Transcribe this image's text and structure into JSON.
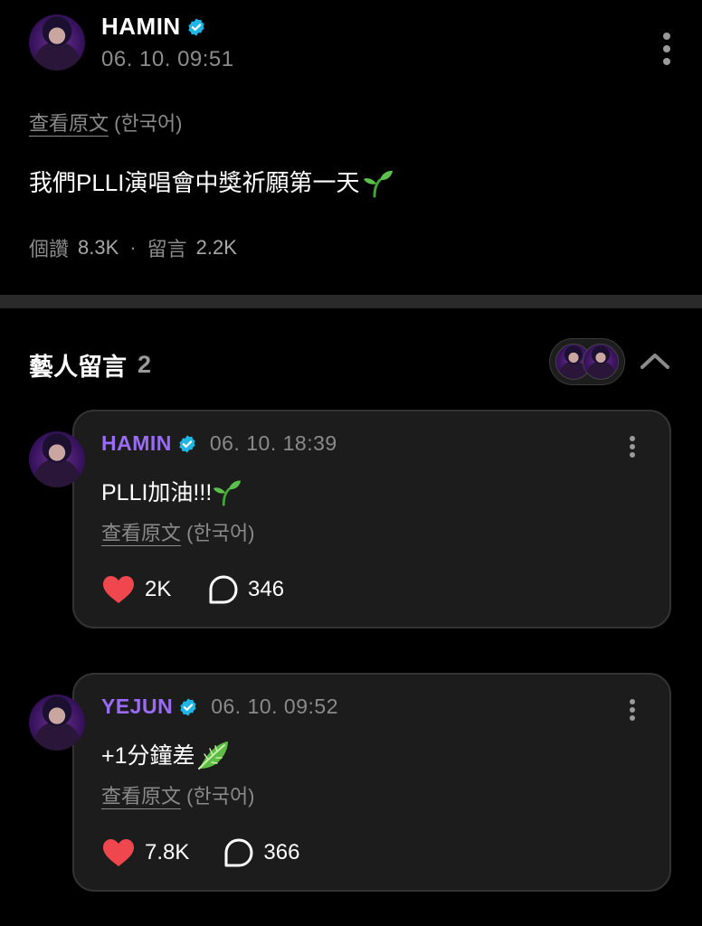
{
  "post": {
    "author": "HAMIN",
    "timestamp": "06. 10. 09:51",
    "translate_link": "查看原文",
    "translate_lang": "(한국어)",
    "body": "我們PLLI演唱會中獎祈願第一天",
    "body_emoji": "sprout-icon",
    "likes_label": "個讚",
    "likes_count": "8.3K",
    "separator": "·",
    "comments_label": "留言",
    "comments_count": "2.2K"
  },
  "artist_comments": {
    "title": "藝人留言",
    "count": "2",
    "items": [
      {
        "author": "HAMIN",
        "timestamp": "06. 10. 18:39",
        "body": "PLLI加油!!!",
        "emoji": "sprout-icon",
        "translate_link": "查看原文",
        "translate_lang": "(한국어)",
        "likes": "2K",
        "replies": "346"
      },
      {
        "author": "YEJUN",
        "timestamp": "06. 10. 09:52",
        "body": "+1分鐘差",
        "emoji": "leafy-green-icon",
        "translate_link": "查看原文",
        "translate_lang": "(한국어)",
        "likes": "7.8K",
        "replies": "366"
      }
    ]
  },
  "colors": {
    "background": "#000000",
    "verified": "#1fb6e6",
    "name_accent": "#9a6cf5",
    "like": "#f0474f",
    "divider": "#2a2a2a",
    "card": "#1c1c1c"
  }
}
